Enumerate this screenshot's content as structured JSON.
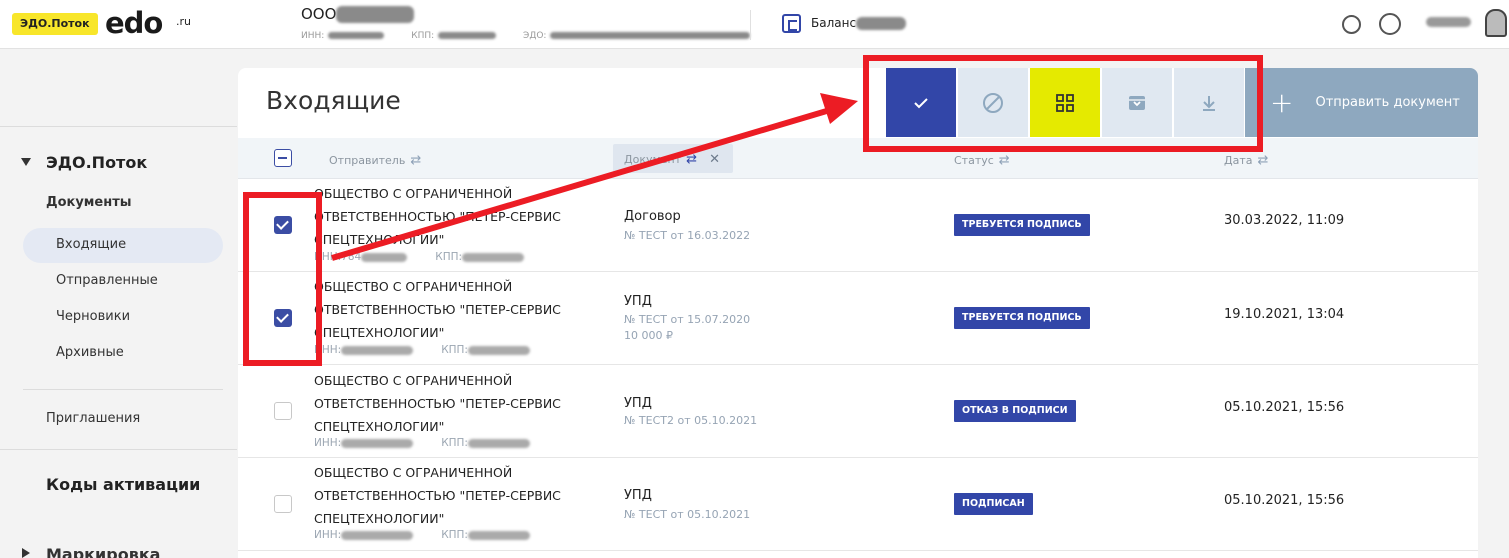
{
  "app": {
    "badge": "ЭДО.Поток",
    "logo": "edo",
    "logo_suffix": ".ru"
  },
  "org": {
    "name_prefix": "ООО",
    "inn_label": "ИНН:",
    "kpp_label": "КПП:",
    "edo_label": "ЭДО:"
  },
  "balance": {
    "label": "Баланс"
  },
  "sidebar": {
    "section": "ЭДО.Поток",
    "documents": "Документы",
    "items": [
      {
        "label": "Входящие",
        "active": true
      },
      {
        "label": "Отправленные"
      },
      {
        "label": "Черновики"
      },
      {
        "label": "Архивные"
      }
    ],
    "invites": "Приглашения",
    "activation": "Коды активации",
    "marking": "Маркировка"
  },
  "page": {
    "title": "Входящие"
  },
  "toolbar": {
    "send_label": "Отправить документ"
  },
  "table": {
    "headers": {
      "sender": "Отправитель",
      "document": "Документ",
      "status": "Статус",
      "date": "Дата"
    },
    "rows": [
      {
        "checked": true,
        "sender": [
          "ОБЩЕСТВО С ОГРАНИЧЕННОЙ",
          "ОТВЕТСТВЕННОСТЬЮ \"ПЕТЕР-СЕРВИС",
          "СПЕЦТЕХНОЛОГИИ\""
        ],
        "inn": "ИНН:784",
        "kpp": "КПП:",
        "doc_type": "Договор",
        "doc_num": "№ ТЕСТ   от 16.03.2022",
        "doc_sum": "",
        "status": "ТРЕБУЕТСЯ ПОДПИСЬ",
        "date": "30.03.2022, 11:09"
      },
      {
        "checked": true,
        "sender": [
          "ОБЩЕСТВО С ОГРАНИЧЕННОЙ",
          "ОТВЕТСТВЕННОСТЬЮ \"ПЕТЕР-СЕРВИС",
          "СПЕЦТЕХНОЛОГИИ\""
        ],
        "inn": "ИНН:",
        "kpp": "КПП:",
        "doc_type": "УПД",
        "doc_num": "№ ТЕСТ   от 15.07.2020",
        "doc_sum": "10 000 ₽",
        "status": "ТРЕБУЕТСЯ ПОДПИСЬ",
        "date": "19.10.2021, 13:04"
      },
      {
        "checked": false,
        "sender": [
          "ОБЩЕСТВО С ОГРАНИЧЕННОЙ",
          "ОТВЕТСТВЕННОСТЬЮ \"ПЕТЕР-СЕРВИС",
          "СПЕЦТЕХНОЛОГИИ\""
        ],
        "inn": "ИНН:",
        "kpp": "КПП:",
        "doc_type": "УПД",
        "doc_num": "№ ТЕСТ2   от 05.10.2021",
        "doc_sum": "",
        "status": "ОТКАЗ В ПОДПИСИ",
        "date": "05.10.2021, 15:56"
      },
      {
        "checked": false,
        "sender": [
          "ОБЩЕСТВО С ОГРАНИЧЕННОЙ",
          "ОТВЕТСТВЕННОСТЬЮ \"ПЕТЕР-СЕРВИС",
          "СПЕЦТЕХНОЛОГИИ\""
        ],
        "inn": "ИНН:",
        "kpp": "КПП:",
        "doc_type": "УПД",
        "doc_num": "№ ТЕСТ   от 05.10.2021",
        "doc_sum": "",
        "status": "ПОДПИСАН",
        "date": "05.10.2021, 15:56"
      }
    ]
  },
  "colors": {
    "brand_yellow": "#f8e62a",
    "primary_blue": "#3246a8",
    "annotation_red": "#ec1c24",
    "send_button": "#8ea8bf"
  }
}
